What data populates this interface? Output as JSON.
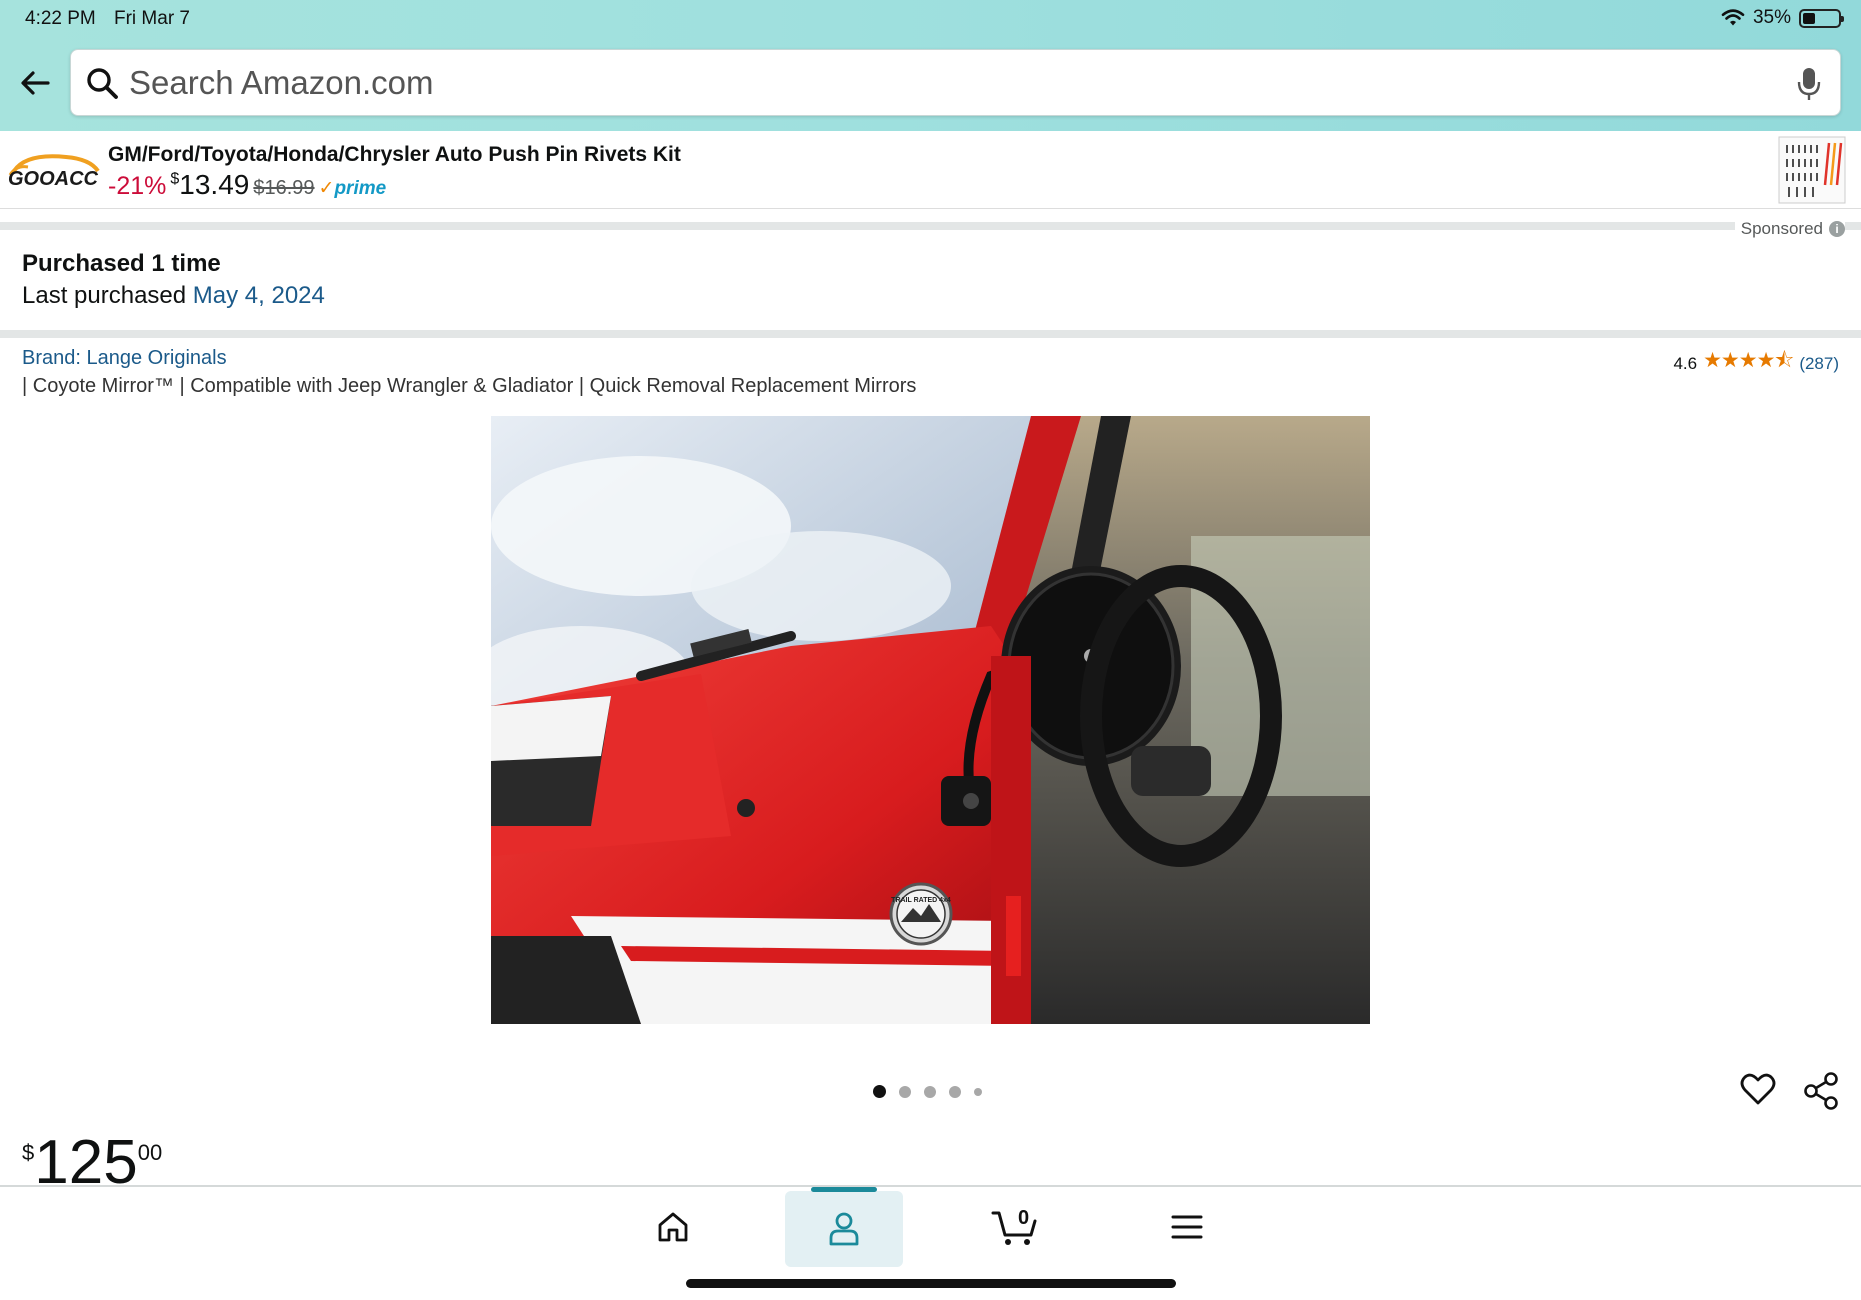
{
  "status_bar": {
    "time": "4:22 PM",
    "date": "Fri Mar 7",
    "battery": "35%"
  },
  "search": {
    "placeholder": "Search Amazon.com"
  },
  "ad": {
    "logo_text": "GOOACC",
    "title": "GM/Ford/Toyota/Honda/Chrysler Auto Push Pin Rivets Kit",
    "discount": "-21%",
    "price_currency": "$",
    "price": "13.49",
    "list_price": "$16.99",
    "prime_label": "prime",
    "sponsored_label": "Sponsored"
  },
  "purchase_history": {
    "count_text": "Purchased 1 time",
    "last_label": "Last purchased",
    "last_date": "May 4, 2024"
  },
  "product": {
    "brand": "Brand: Lange Originals",
    "subtitle": "| Coyote Mirror™ | Compatible with Jeep Wrangler & Gladiator | Quick Removal Replacement Mirrors",
    "rating": "4.6",
    "stars": "★★★★⯪",
    "rating_count": "(287)",
    "image_count": 5,
    "active_image": 1,
    "price_currency": "$",
    "price_whole": "125",
    "price_fraction": "00",
    "badge_text": "TRAIL RATED 4x4"
  },
  "tabbar": {
    "cart_count": "0",
    "items": [
      "home-icon",
      "account-icon",
      "cart-icon",
      "menu-icon"
    ],
    "active": "account-icon"
  },
  "colors": {
    "header_gradient_start": "#a6e3dd",
    "header_gradient_end": "#92d9da",
    "link": "#1b5a8a",
    "discount": "#cc0c39",
    "prime": "#1399c6",
    "star": "#e67a00",
    "active_tab": "#1b8a9a"
  }
}
